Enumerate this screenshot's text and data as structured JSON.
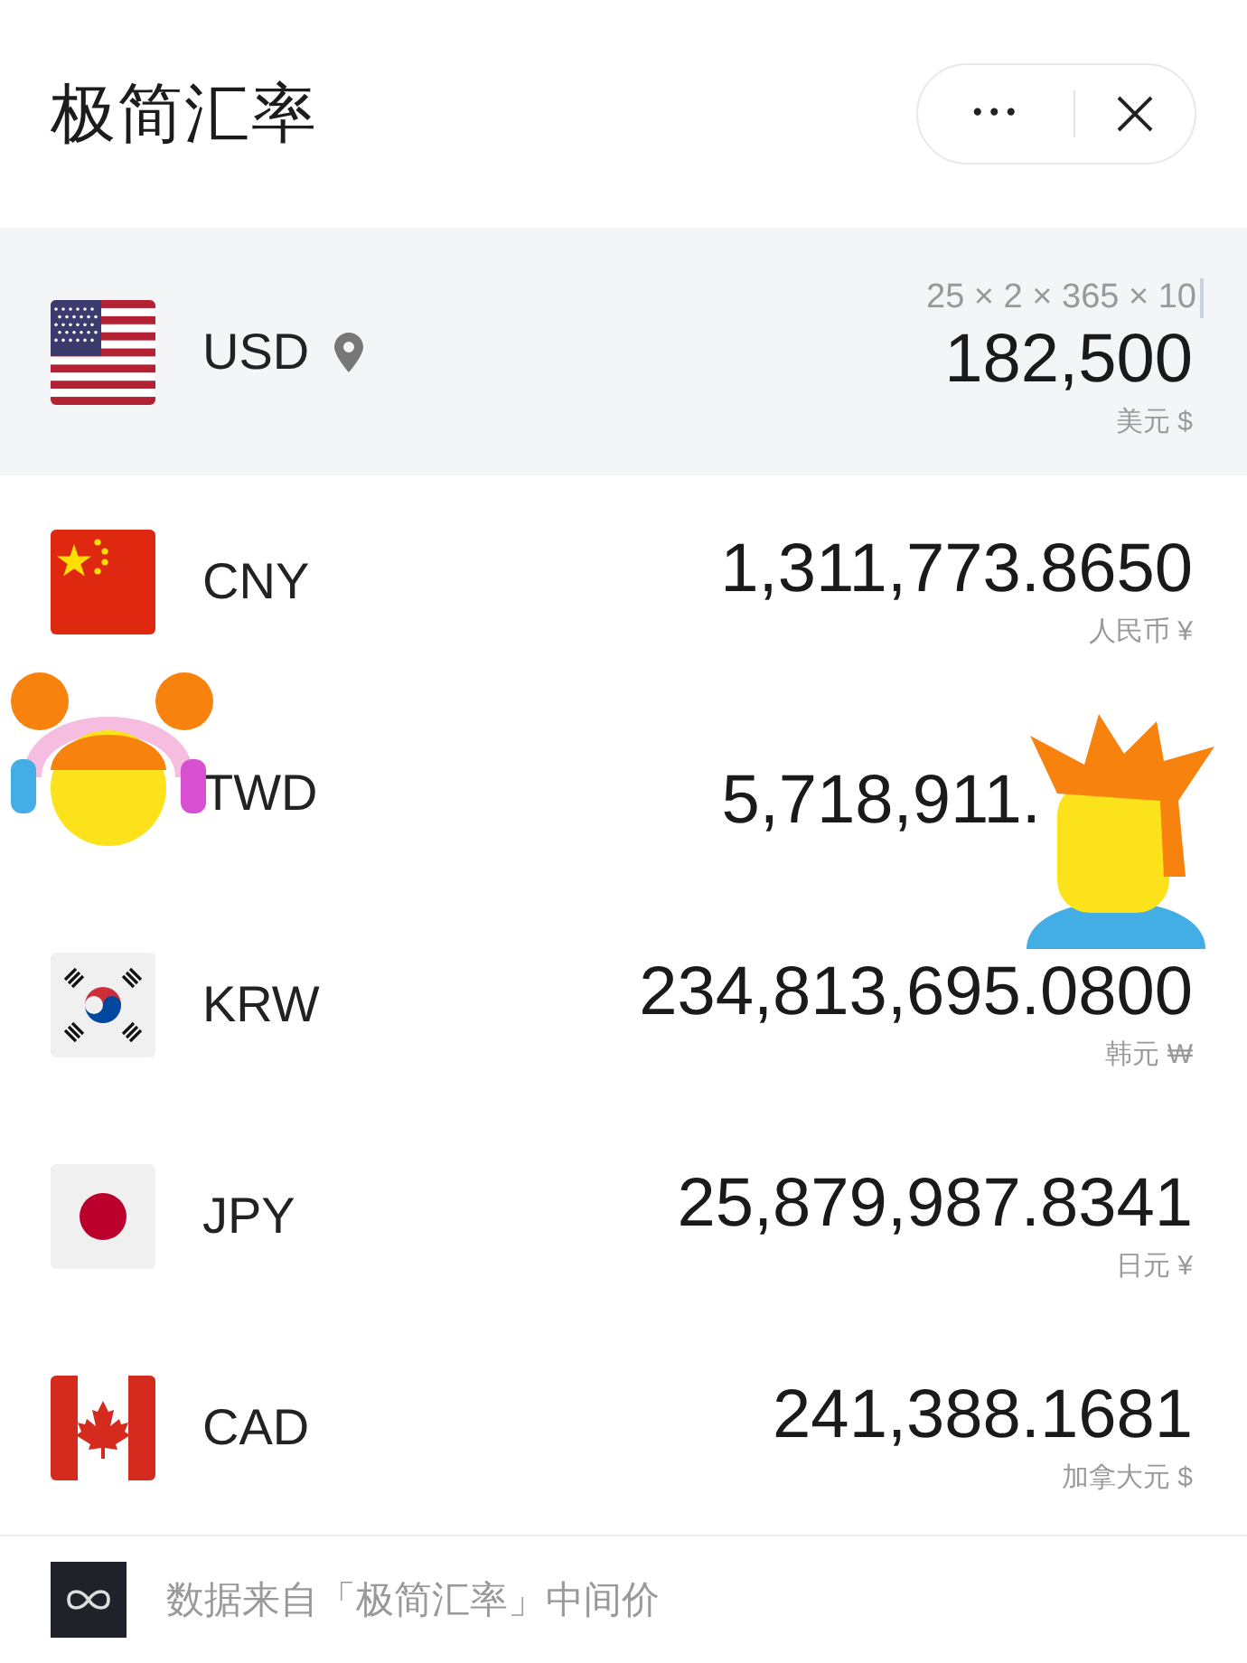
{
  "header": {
    "title": "极简汇率",
    "more_button": "•••"
  },
  "rows": [
    {
      "kind": "us",
      "code": "USD",
      "location": true,
      "selected": true,
      "expression": "25 × 2 × 365 × 10",
      "value": "182,500",
      "name": "美元 $"
    },
    {
      "kind": "cn",
      "code": "CNY",
      "location": false,
      "selected": false,
      "value": "1,311,773.8650",
      "name": "人民币 ¥"
    },
    {
      "code": "TWD",
      "location": false,
      "selected": false,
      "value": "5,718,911.",
      "sticker": true
    },
    {
      "kind": "kr",
      "code": "KRW",
      "location": false,
      "selected": false,
      "value": "234,813,695.0800",
      "name": "韩元 ₩"
    },
    {
      "kind": "jp",
      "code": "JPY",
      "location": false,
      "selected": false,
      "value": "25,879,987.8341",
      "name": "日元 ¥"
    },
    {
      "kind": "ca",
      "code": "CAD",
      "location": false,
      "selected": false,
      "value": "241,388.1681",
      "name": "加拿大元 $"
    }
  ],
  "footer": {
    "text": "数据来自「极简汇率」中间价"
  }
}
